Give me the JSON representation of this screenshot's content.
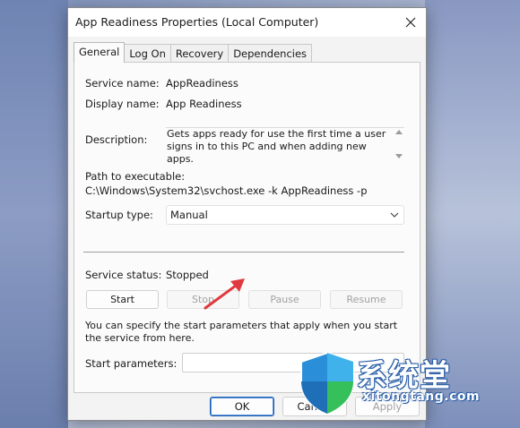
{
  "window": {
    "title": "App Readiness Properties (Local Computer)"
  },
  "tabs": [
    {
      "label": "General",
      "active": true
    },
    {
      "label": "Log On",
      "active": false
    },
    {
      "label": "Recovery",
      "active": false
    },
    {
      "label": "Dependencies",
      "active": false
    }
  ],
  "general": {
    "service_name_label": "Service name:",
    "service_name": "AppReadiness",
    "display_name_label": "Display name:",
    "display_name": "App Readiness",
    "description_label": "Description:",
    "description": "Gets apps ready for use the first time a user signs in to this PC and when adding new apps.",
    "path_label": "Path to executable:",
    "path": "C:\\Windows\\System32\\svchost.exe -k AppReadiness -p",
    "startup_type_label": "Startup type:",
    "startup_type": "Manual",
    "service_status_label": "Service status:",
    "service_status": "Stopped",
    "buttons": {
      "start": "Start",
      "stop": "Stop",
      "pause": "Pause",
      "resume": "Resume"
    },
    "hint": "You can specify the start parameters that apply when you start the service from here.",
    "start_params_label": "Start parameters:",
    "start_params_value": ""
  },
  "dialog_buttons": {
    "ok": "OK",
    "cancel": "Cancel",
    "apply": "Apply"
  },
  "watermark": {
    "text_cn": "系统堂",
    "text_en": "xitongtang.com"
  },
  "colors": {
    "accent": "#1a5fb4",
    "annotation_arrow": "#e0393e",
    "disabled_text": "#a2a2a2"
  },
  "icons": {
    "close": "close-icon",
    "dropdown": "chevron-down-icon",
    "annotation": "red-arrow-icon"
  }
}
